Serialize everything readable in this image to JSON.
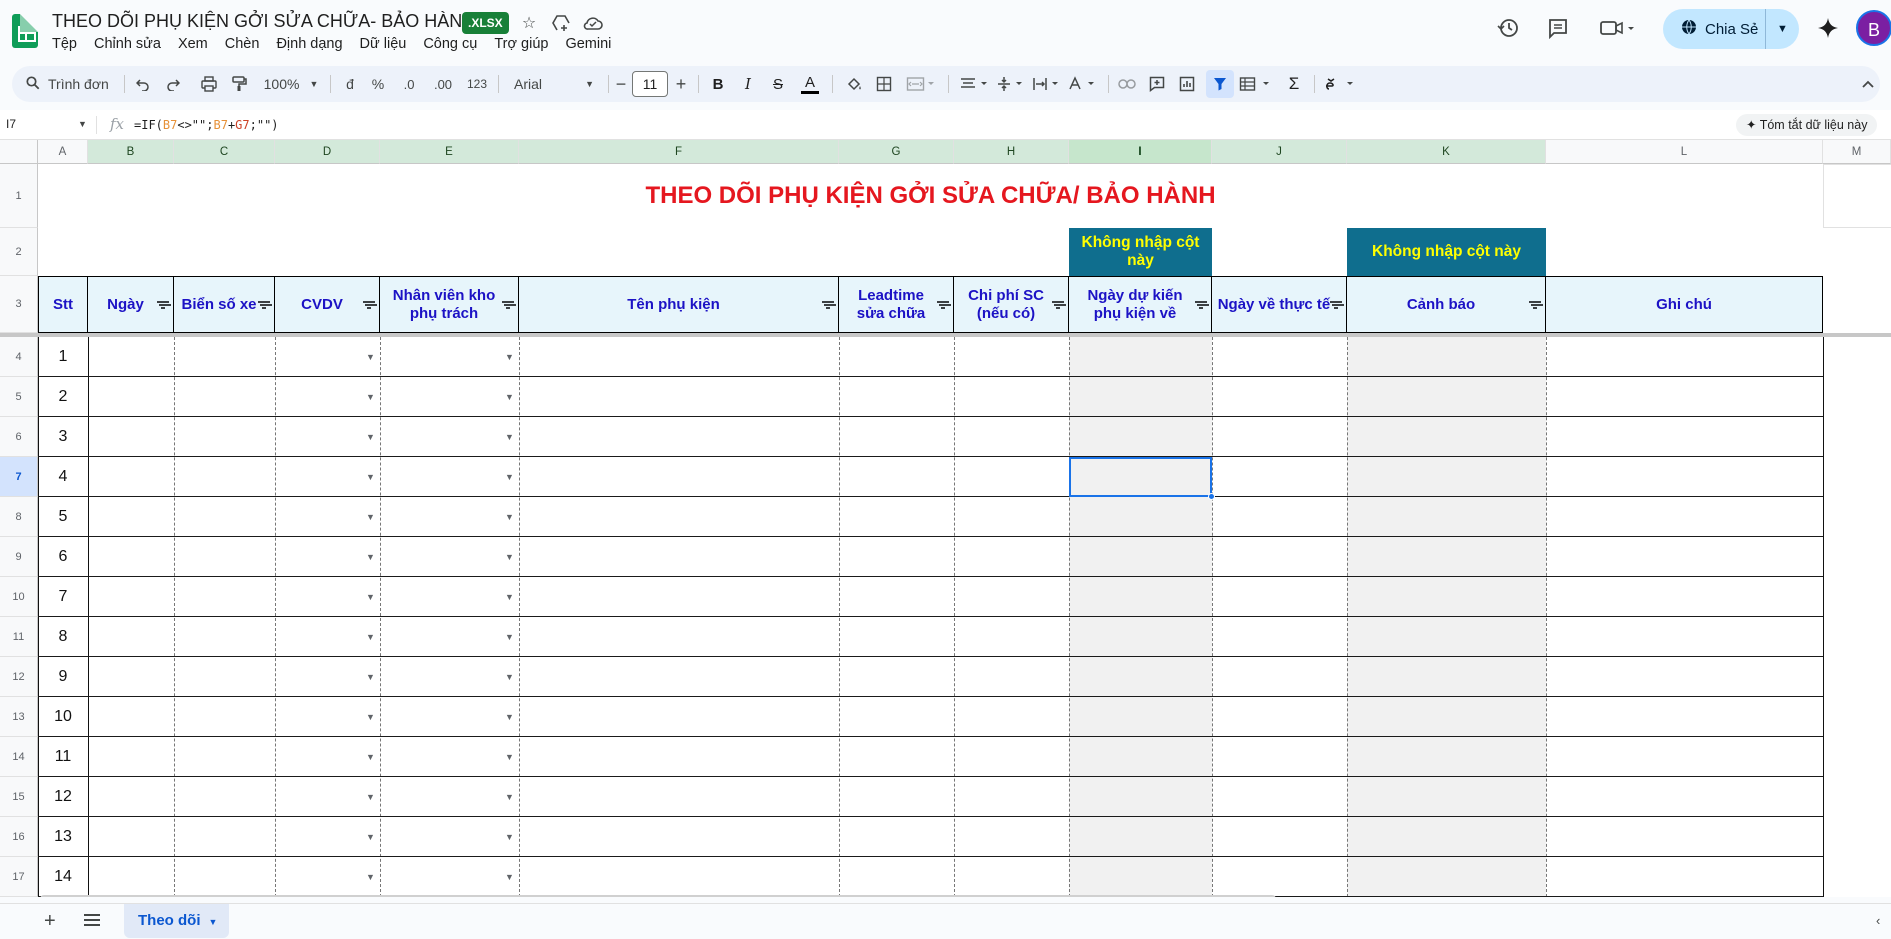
{
  "doc": {
    "title": "THEO DÕI PHỤ KIỆN GỞI SỬA CHỮA- BẢO HÀNH",
    "badge": ".XLSX"
  },
  "menu": [
    "Tệp",
    "Chỉnh sửa",
    "Xem",
    "Chèn",
    "Định dạng",
    "Dữ liệu",
    "Công cụ",
    "Trợ giúp",
    "Gemini"
  ],
  "share": {
    "label": "Chia Sẻ",
    "avatar": "B"
  },
  "toolbar": {
    "search": "Trình đơn",
    "zoom": "100%",
    "currency": "đ",
    "percent": "%",
    "dec_less": ".0",
    "dec_more": ".00",
    "number_fmt": "123",
    "font": "Arial",
    "font_size": "11",
    "bold": "B",
    "italic": "I",
    "strike": "S",
    "text_color": "A",
    "sum": "Σ"
  },
  "formula_bar": {
    "cell_ref": "I7",
    "fx": "fx",
    "formula_prefix": "=IF(",
    "ref1": "B7",
    "formula_mid1": "<>\"\";",
    "ref2": "B7",
    "formula_mid2": "+",
    "ref3": "G7",
    "formula_suffix": ";\"\")",
    "summary_button": "✦ Tóm tắt dữ liệu này"
  },
  "columns": [
    "A",
    "B",
    "C",
    "D",
    "E",
    "F",
    "G",
    "H",
    "I",
    "J",
    "K",
    "L",
    "M"
  ],
  "rows": [
    "1",
    "2",
    "3",
    "4",
    "5",
    "6",
    "7",
    "8",
    "9",
    "10",
    "11",
    "12",
    "13",
    "14",
    "15",
    "16",
    "17"
  ],
  "sheet": {
    "title": "THEO DÕI PHỤ KIỆN GỞI SỬA CHỮA/ BẢO HÀNH",
    "warning_i": "Không nhập cột này",
    "warning_k": "Không nhập cột này",
    "headers": {
      "stt": "Stt",
      "ngay": "Ngày",
      "bien_so": "Biển số xe",
      "cvdv": "CVDV",
      "nhan_vien": "Nhân viên kho phụ trách",
      "ten_phu_kien": "Tên phụ kiện",
      "leadtime": "Leadtime sửa chữa",
      "chi_phi": "Chi phí SC (nếu có)",
      "ngay_du_kien": "Ngày dự kiến phụ kiện về",
      "ngay_ve": "Ngày về thực tế",
      "canh_bao": "Cảnh báo",
      "ghi_chu": "Ghi chú"
    },
    "stt_values": [
      "1",
      "2",
      "3",
      "4",
      "5",
      "6",
      "7",
      "8",
      "9",
      "10",
      "11",
      "12",
      "13",
      "14"
    ],
    "selected_cell": "I7"
  },
  "tabs": {
    "active": "Theo dõi"
  },
  "colors": {
    "title_red": "#e5171f",
    "header_blue_text": "#1c12c5",
    "header_bg": "#e7f5fb",
    "warning_bg": "#0f6e8e",
    "warning_text": "#ffff00",
    "sheets_green": "#0f9d58",
    "share_bg": "#c2e7ff"
  }
}
